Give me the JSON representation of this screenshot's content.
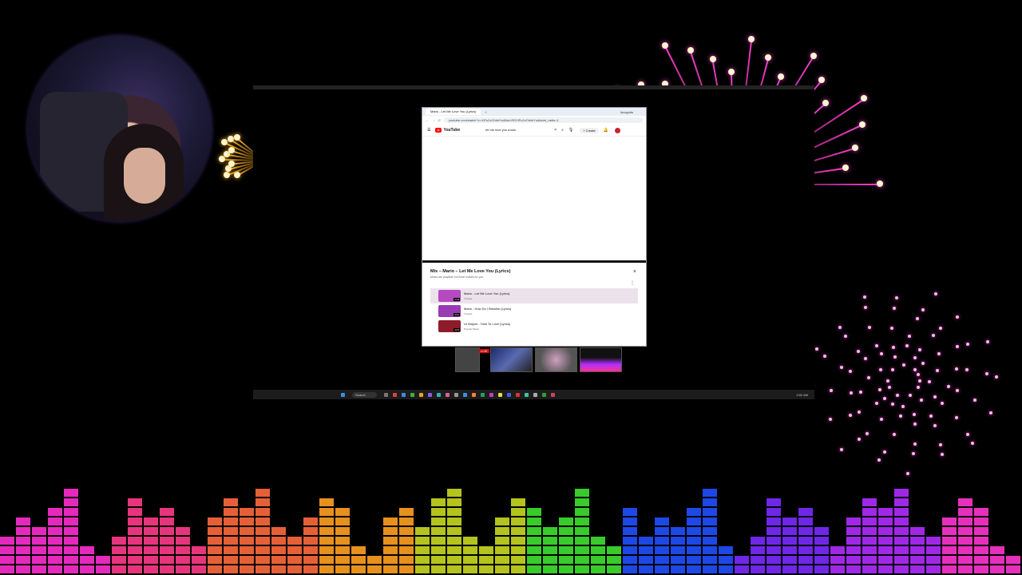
{
  "browser": {
    "tab_title": "Mario - Let Me Love You (Lyrics)",
    "new_tab": "+",
    "profile_label": "Incognito",
    "url": "youtube.com/watch?v=XiFu2vOhhkYw&list=RDXiFu2vOhhkYw&start_radio=1",
    "nav_back": "←",
    "nav_forward": "→",
    "nav_reload": "C"
  },
  "youtube": {
    "logo_text": "YouTube",
    "menu_icon": "☰",
    "search_value": "let me love you mario",
    "clear_icon": "×",
    "search_icon": "⌕",
    "mic_icon": "🎙",
    "create_label": "+ Create",
    "bell_icon": "🔔"
  },
  "mix": {
    "title": "Mix – Mario – Let Me Love You (Lyrics)",
    "subtitle": "Mixes are playlists YouTube makes for you",
    "close_icon": "×",
    "more_icon": "⋮",
    "items": [
      {
        "title": "Mario - Let Me Love You (Lyrics)",
        "channel": "7clouds",
        "duration": "4:14",
        "color": "#b44ac0"
      },
      {
        "title": "Mario - How Do I Breathe (Lyrics)",
        "channel": "7clouds",
        "duration": "3:51",
        "color": "#9a3bb4"
      },
      {
        "title": "Lil Wayne - How To Love (Lyrics)",
        "channel": "Popular Music",
        "duration": "4:03",
        "color": "#8e1b2a"
      }
    ]
  },
  "overlay": {
    "live_badge": "LIVE"
  },
  "taskbar": {
    "search_label": "Search",
    "clock": "2:52 AM"
  },
  "theme": {
    "eq_colors": [
      "#ff2ed1",
      "#ff3b8a",
      "#ff6a3d",
      "#ffa020",
      "#c8d820",
      "#3fe030",
      "#2050ff",
      "#7a2bff",
      "#b02cff",
      "#ff35d0"
    ]
  }
}
